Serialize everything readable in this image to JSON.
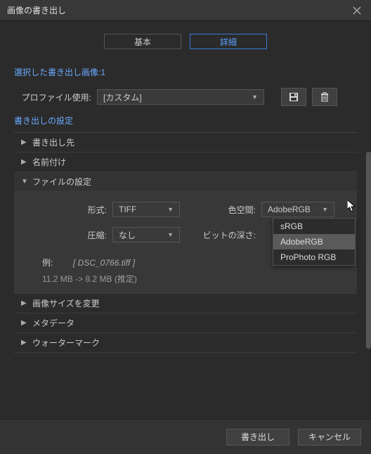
{
  "titlebar": {
    "title": "画像の書き出し"
  },
  "tabs": {
    "basic": "基本",
    "advanced": "詳細"
  },
  "selection": {
    "header": "選択した書き出し画像:1"
  },
  "profile": {
    "label": "プロファイル使用:",
    "value": "[カスタム]"
  },
  "settings_title": "書き出しの設定",
  "acc": {
    "destination": "書き出し先",
    "naming": "名前付け",
    "file": "ファイルの設定",
    "resize": "画像サイズを変更",
    "metadata": "メタデータ",
    "watermark": "ウォーターマーク"
  },
  "file_settings": {
    "format_label": "形式:",
    "format_value": "TIFF",
    "colorspace_label": "色空間:",
    "colorspace_value": "AdobeRGB",
    "compression_label": "圧縮:",
    "compression_value": "なし",
    "bitdepth_label": "ビットの深さ:",
    "example_label": "例:",
    "example_value": "[ DSC_0766.tiff ]",
    "size_text": "11.2 MB -> 8.2 MB (推定)"
  },
  "colorspace_options": {
    "srgb": "sRGB",
    "adobergb": "AdobeRGB",
    "prophoto": "ProPhoto RGB"
  },
  "footer": {
    "export": "書き出し",
    "cancel": "キャンセル"
  }
}
